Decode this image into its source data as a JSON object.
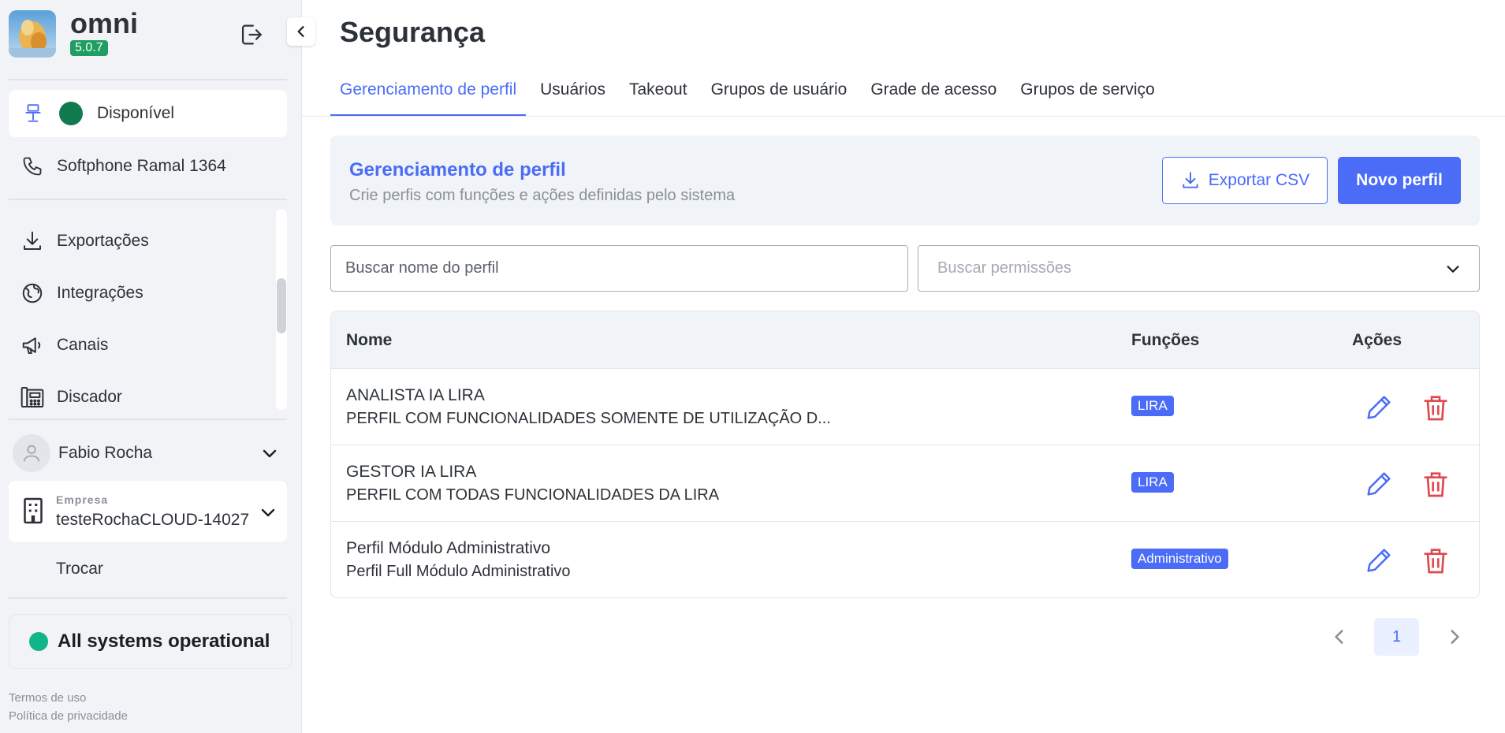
{
  "brand": {
    "name": "omni",
    "version": "5.0.7"
  },
  "sidebar": {
    "status": {
      "label": "Disponível"
    },
    "softphone": {
      "label": "Softphone Ramal 1364"
    },
    "nav": [
      {
        "label": "Exportações"
      },
      {
        "label": "Integrações"
      },
      {
        "label": "Canais"
      },
      {
        "label": "Discador"
      }
    ],
    "user": {
      "name": "Fabio Rocha"
    },
    "company": {
      "label": "Empresa",
      "name": "testeRochaCLOUD-14027"
    },
    "switch_label": "Trocar",
    "system_status": "All systems operational",
    "footer": {
      "terms": "Termos de uso",
      "privacy": "Política de privacidade"
    }
  },
  "page": {
    "title": "Segurança",
    "tabs": [
      {
        "label": "Gerenciamento de perfil"
      },
      {
        "label": "Usuários"
      },
      {
        "label": "Takeout"
      },
      {
        "label": "Grupos de usuário"
      },
      {
        "label": "Grade de acesso"
      },
      {
        "label": "Grupos de serviço"
      }
    ],
    "hero": {
      "title": "Gerenciamento de perfil",
      "subtitle": "Crie perfis com funções e ações definidas pelo sistema",
      "export_label": "Exportar CSV",
      "new_label": "Novo perfil"
    },
    "filters": {
      "name_placeholder": "Buscar nome do perfil",
      "perms_placeholder": "Buscar permissões"
    },
    "table": {
      "headers": {
        "name": "Nome",
        "functions": "Funções",
        "actions": "Ações"
      },
      "rows": [
        {
          "name": "ANALISTA IA LIRA",
          "description": "PERFIL COM FUNCIONALIDADES SOMENTE DE UTILIZAÇÃO D...",
          "function": "LIRA"
        },
        {
          "name": "GESTOR IA LIRA",
          "description": "PERFIL COM TODAS FUNCIONALIDADES DA LIRA",
          "function": "LIRA"
        },
        {
          "name": "Perfil Módulo Administrativo",
          "description": "Perfil Full Módulo Administrativo",
          "function": "Administrativo"
        }
      ]
    },
    "pagination": {
      "current": "1"
    }
  },
  "colors": {
    "accent": "#4a6cf7",
    "status_green": "#127a4f",
    "system_green": "#12b48a",
    "danger": "#e0484f"
  }
}
